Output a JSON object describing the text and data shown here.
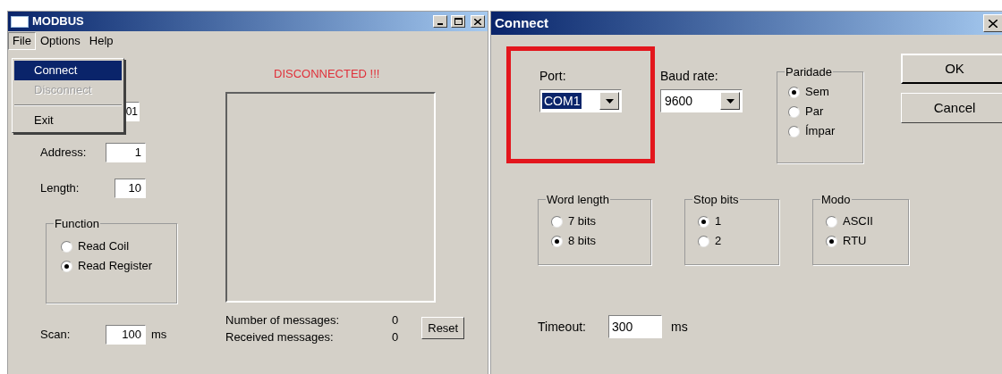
{
  "main_window": {
    "title": "MODBUS",
    "menu": [
      {
        "label": "File",
        "selected": true
      },
      {
        "label": "Options",
        "selected": false
      },
      {
        "label": "Help",
        "selected": false
      }
    ],
    "file_menu": [
      {
        "kind": "item",
        "label": "Connect",
        "selected": true,
        "disabled": false
      },
      {
        "kind": "item",
        "label": "Disconnect",
        "selected": false,
        "disabled": true
      },
      {
        "kind": "separator"
      },
      {
        "kind": "item",
        "label": "Exit",
        "selected": false,
        "disabled": false
      }
    ],
    "device_field": {
      "value": "01"
    },
    "fields": [
      {
        "label": "Address:",
        "value": "1"
      },
      {
        "label": "Length:",
        "value": "10"
      }
    ],
    "function_group": {
      "title": "Function",
      "options": [
        {
          "label": "Read Coil",
          "selected": false
        },
        {
          "label": "Read Register",
          "selected": true
        }
      ]
    },
    "scan": {
      "label": "Scan:",
      "value": "100",
      "unit": "ms"
    },
    "status": "DISCONNECTED !!!",
    "counters": [
      {
        "label": "Number of messages:",
        "value": "0"
      },
      {
        "label": "Received messages:",
        "value": "0"
      }
    ],
    "reset_button": "Reset"
  },
  "connect_dialog": {
    "title": "Connect",
    "port": {
      "label": "Port:",
      "value": "COM1",
      "focused": true,
      "highlighted": true
    },
    "baud": {
      "label": "Baud rate:",
      "value": "9600",
      "focused": false,
      "highlighted": false
    },
    "parity_group": {
      "title": "Paridade",
      "options": [
        {
          "label": "Sem",
          "selected": true
        },
        {
          "label": "Par",
          "selected": false
        },
        {
          "label": "Ímpar",
          "selected": false
        }
      ]
    },
    "groups": [
      {
        "title": "Word length",
        "options": [
          {
            "label": "7 bits",
            "selected": false
          },
          {
            "label": "8 bits",
            "selected": true
          }
        ]
      },
      {
        "title": "Stop bits",
        "options": [
          {
            "label": "1",
            "selected": true
          },
          {
            "label": "2",
            "selected": false
          }
        ]
      },
      {
        "title": "Modo",
        "options": [
          {
            "label": "ASCII",
            "selected": false
          },
          {
            "label": "RTU",
            "selected": true
          }
        ]
      }
    ],
    "buttons": [
      "OK",
      "Cancel"
    ],
    "timeout": {
      "label": "Timeout:",
      "value": "300",
      "unit": "ms"
    }
  }
}
